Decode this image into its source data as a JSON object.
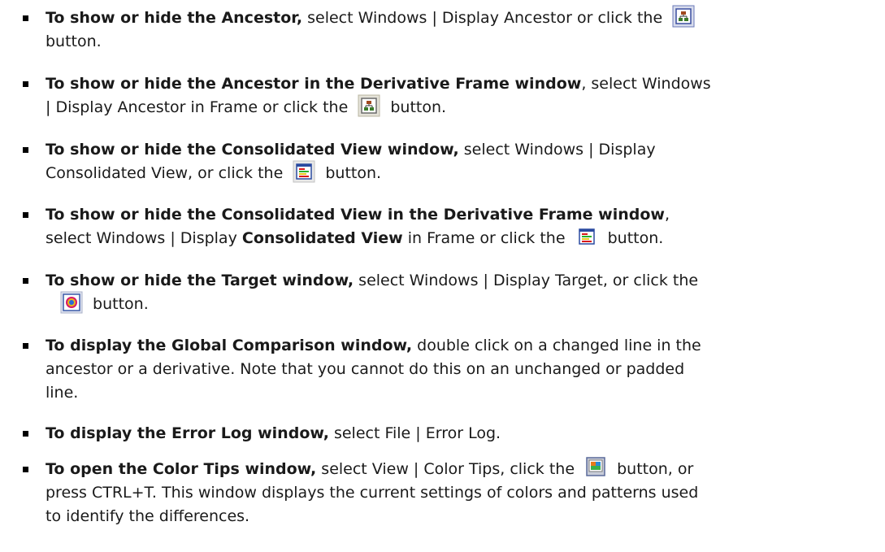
{
  "items": [
    {
      "bold": "To show or hide the Ancestor,",
      "l1": " select Windows | Display Ancestor or click the ",
      "l2": "button."
    },
    {
      "bold": "To show or hide the Ancestor in the Derivative Frame window",
      "l1": ", select Windows",
      "l2a": "| Display Ancestor in Frame or click the ",
      "l2b": " button."
    },
    {
      "bold": "To show or hide the Consolidated View window,",
      "l1": " select Windows | Display",
      "l2a": "Consolidated View, or click the ",
      "l2b": " button."
    },
    {
      "bold": "To show or hide the Consolidated View in the Derivative Frame window",
      "l1": ",",
      "l2a": "select Windows | Display ",
      "l2bold": "Consolidated View",
      "l2b": " in Frame or click the ",
      "l2c": " button."
    },
    {
      "bold": "To show or hide the Target window,",
      "l1": " select Windows | Display Target, or click the",
      "l2": " button."
    },
    {
      "bold": "To display the Global Comparison window,",
      "l1": " double click on a changed line in the",
      "l2": "ancestor or a derivative. Note that you cannot do this on an unchanged or padded",
      "l3": "line."
    },
    {
      "bold": "To display the Error Log window,",
      "l1": " select File | Error Log."
    },
    {
      "bold": "To open the Color Tips window,",
      "l1": " select View | Color Tips, click the ",
      "l1b": " button, or",
      "l2": "press CTRL+T. This window displays the current settings of colors and patterns used",
      "l3": "to identify the differences."
    }
  ],
  "icons": {
    "ancestor": "ancestor-icon",
    "consolidated": "consolidated-view-icon",
    "target": "target-icon",
    "color_tips": "color-tips-icon"
  }
}
